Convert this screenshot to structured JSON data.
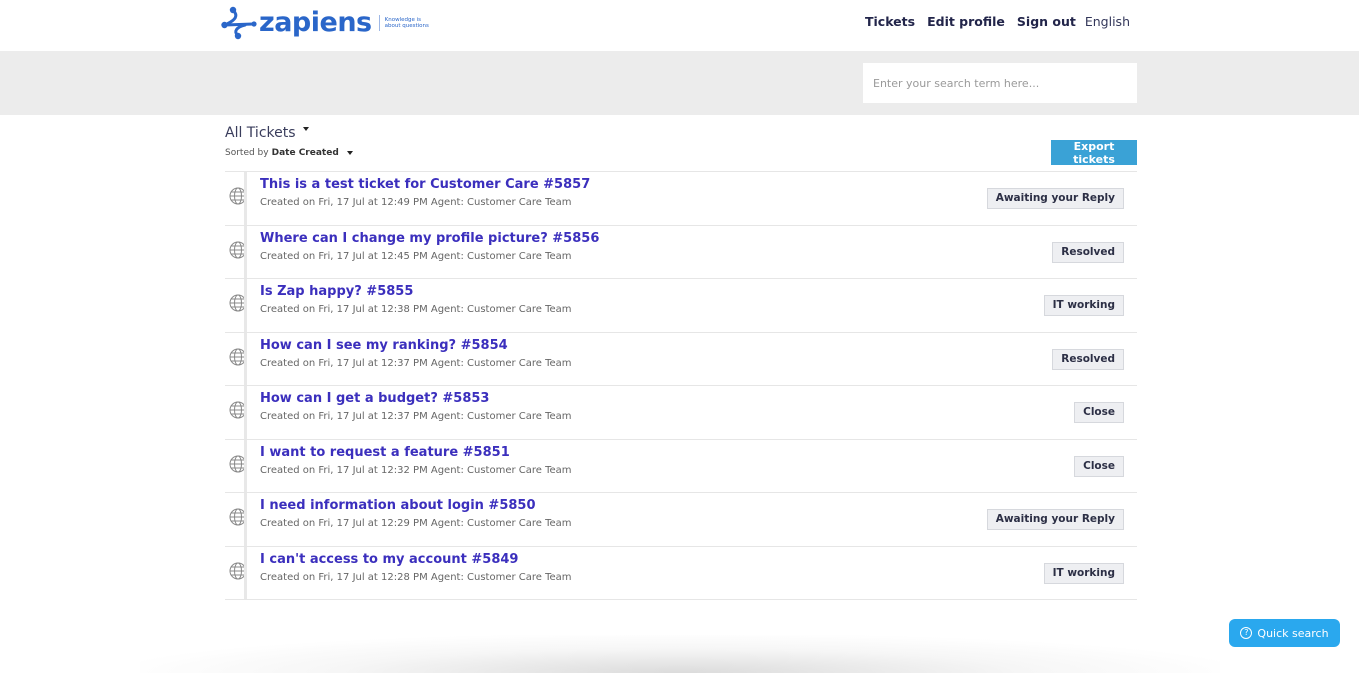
{
  "brand": {
    "name": "zapiens",
    "tagline_line1": "Knowledge is",
    "tagline_line2": "about questions",
    "color": "#2a66c9"
  },
  "nav": {
    "tickets": "Tickets",
    "edit_profile": "Edit profile",
    "sign_out": "Sign out",
    "language": "English"
  },
  "search": {
    "placeholder": "Enter your search term here..."
  },
  "toolbar": {
    "filter_label": "All Tickets",
    "sorted_prefix": "Sorted by",
    "sorted_value": "Date Created",
    "export_label": "Export tickets",
    "export_color": "#3aa2d6"
  },
  "tickets": [
    {
      "title": "This is a test ticket for Customer Care #5857",
      "meta": "Created on Fri, 17 Jul at 12:49 PM Agent: Customer Care Team",
      "status": "Awaiting your Reply"
    },
    {
      "title": "Where can I change my profile picture? #5856",
      "meta": "Created on Fri, 17 Jul at 12:45 PM Agent: Customer Care Team",
      "status": "Resolved"
    },
    {
      "title": "Is Zap happy? #5855",
      "meta": "Created on Fri, 17 Jul at 12:38 PM Agent: Customer Care Team",
      "status": "IT working"
    },
    {
      "title": "How can I see my ranking? #5854",
      "meta": "Created on Fri, 17 Jul at 12:37 PM Agent: Customer Care Team",
      "status": "Resolved"
    },
    {
      "title": "How can I get a budget? #5853",
      "meta": "Created on Fri, 17 Jul at 12:37 PM Agent: Customer Care Team",
      "status": "Close"
    },
    {
      "title": "I want to request a feature #5851",
      "meta": "Created on Fri, 17 Jul at 12:32 PM Agent: Customer Care Team",
      "status": "Close"
    },
    {
      "title": "I need information about login #5850",
      "meta": "Created on Fri, 17 Jul at 12:29 PM Agent: Customer Care Team",
      "status": "Awaiting your Reply"
    },
    {
      "title": "I can't access to my account #5849",
      "meta": "Created on Fri, 17 Jul at 12:28 PM Agent: Customer Care Team",
      "status": "IT working"
    }
  ],
  "quick_search": {
    "label": "Quick search",
    "icon": "help-circle-icon",
    "color": "#2aa8ee"
  }
}
